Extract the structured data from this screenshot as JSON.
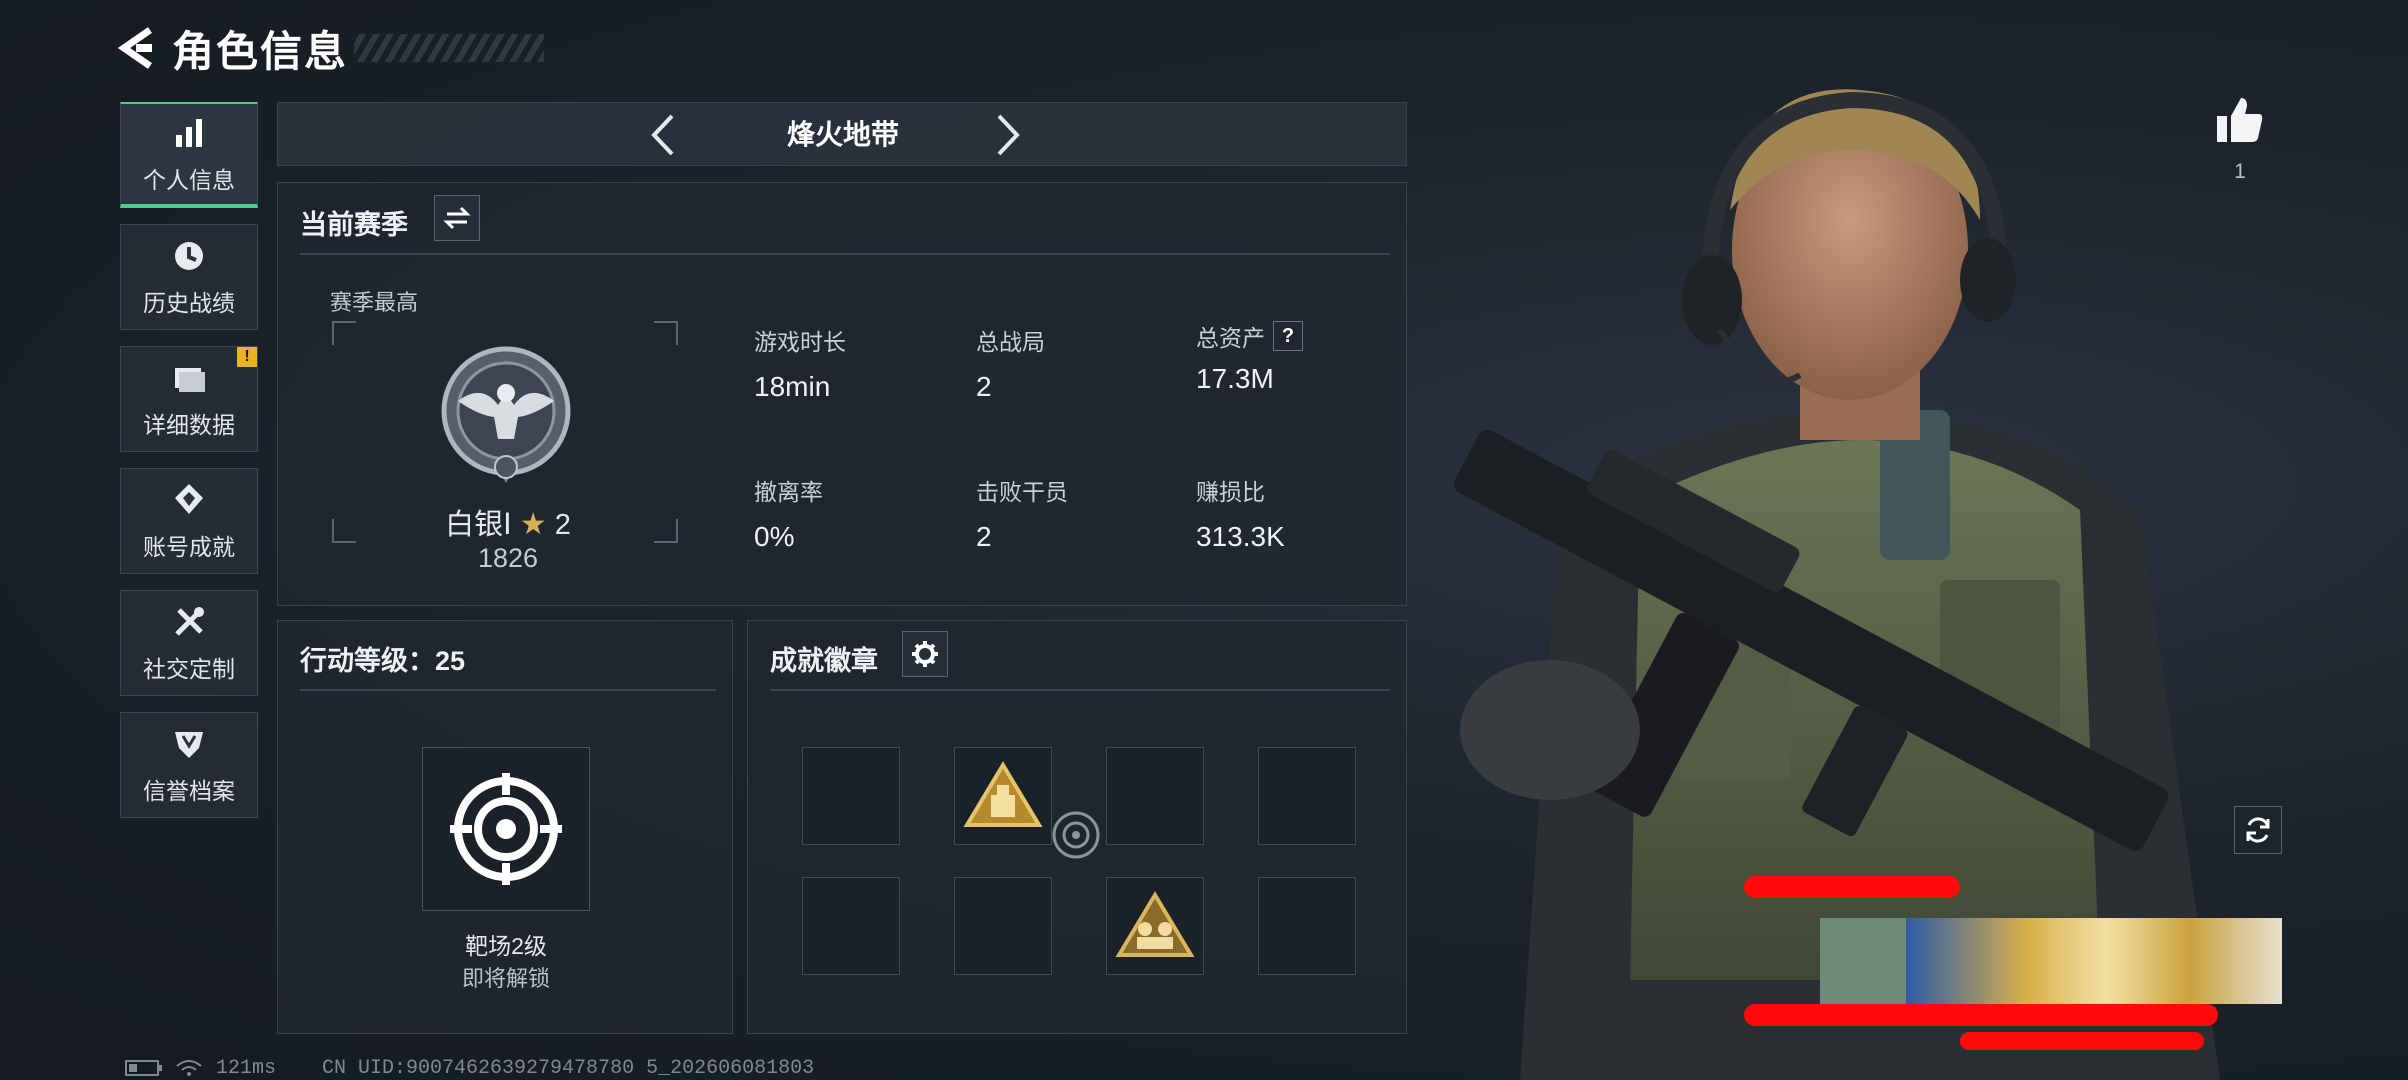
{
  "header": {
    "title": "角色信息"
  },
  "sidebar": {
    "items": [
      {
        "label": "个人信息",
        "icon": "bar-chart-icon",
        "active": true
      },
      {
        "label": "历史战绩",
        "icon": "history-clock-icon",
        "active": false
      },
      {
        "label": "详细数据",
        "icon": "folder-icon",
        "active": false,
        "alert": "!"
      },
      {
        "label": "账号成就",
        "icon": "achievement-icon",
        "active": false
      },
      {
        "label": "社交定制",
        "icon": "tools-icon",
        "active": false
      },
      {
        "label": "信誉档案",
        "icon": "shield-icon",
        "active": false
      }
    ]
  },
  "mode": {
    "label": "烽火地带"
  },
  "season": {
    "title": "当前赛季",
    "best_label": "赛季最高",
    "rank_name": "白银Ⅰ",
    "rank_stars": "2",
    "rank_points": "1826",
    "stats": [
      {
        "label": "游戏时长",
        "value": "18min"
      },
      {
        "label": "总战局",
        "value": "2"
      },
      {
        "label": "总资产",
        "value": "17.3M",
        "help": "?"
      },
      {
        "label": "撤离率",
        "value": "0%"
      },
      {
        "label": "击败干员",
        "value": "2"
      },
      {
        "label": "赚损比",
        "value": "313.3K"
      }
    ]
  },
  "level": {
    "title": "行动等级：25",
    "unlock_name": "靶场2级",
    "unlock_status": "即将解锁"
  },
  "badges": {
    "title": "成就徽章"
  },
  "likes": {
    "count": "1"
  },
  "status": {
    "ping": "121ms",
    "uid": "CN UID:9007462639279478780 5_202606081803"
  },
  "colors": {
    "accent": "#4fd08a",
    "alert": "#e8b325",
    "redaction": "#ff0a0a"
  }
}
